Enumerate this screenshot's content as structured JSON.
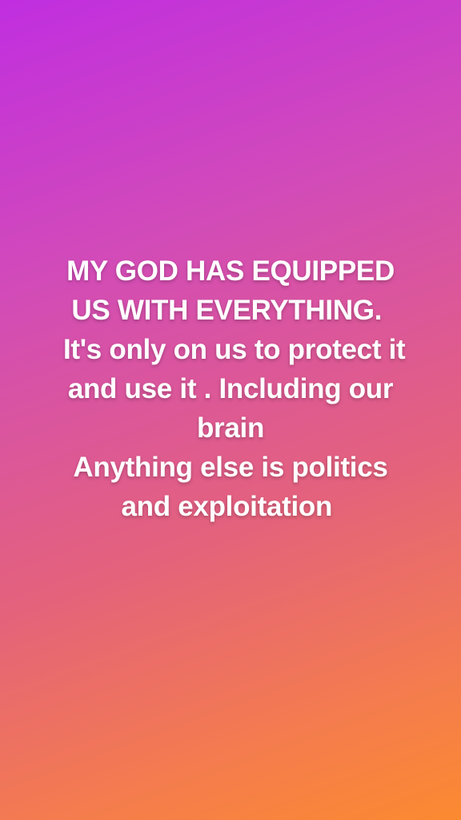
{
  "story": {
    "lines": [
      "MY GOD HAS EQUIPPED",
      "US WITH EVERYTHING. ",
      " It's only on us to protect it",
      "and use it . Including our",
      "brain",
      "Anything else is politics",
      "and exploitation "
    ]
  },
  "colors": {
    "gradient_start": "#c02ee0",
    "gradient_end": "#fb8a30",
    "text": "#ffffff"
  }
}
